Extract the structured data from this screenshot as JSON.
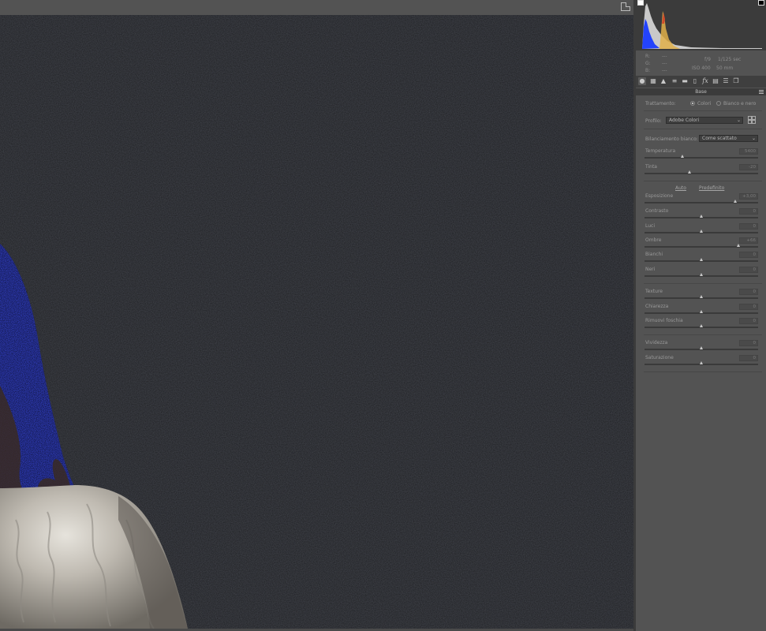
{
  "info": {
    "r_label": "R:",
    "g_label": "G:",
    "b_label": "B:",
    "r_value": "---",
    "g_value": "---",
    "b_value": "---",
    "aperture": "f/9",
    "shutter": "1/125 sec",
    "iso": "ISO 400",
    "focal": "50 mm"
  },
  "tools": [
    "basic-icon",
    "tone-curve-icon",
    "detail-icon",
    "hsl-icon",
    "split-toning-icon",
    "lens-icon",
    "effects-icon",
    "calibration-icon",
    "presets-icon",
    "snapshots-icon"
  ],
  "panel": {
    "section_title": "Base",
    "treatment_label": "Trattamento:",
    "treatment_color": "Colori",
    "treatment_bw": "Bianco e nero",
    "profile_label": "Profilo:",
    "profile_value": "Adobe Colori",
    "wb_label": "Bilanciamento bianco:",
    "wb_value": "Come scattato",
    "auto_label": "Auto",
    "default_label": "Predefinito"
  },
  "sliders": [
    {
      "key": "temperatura",
      "name": "Temperatura",
      "value": "5400",
      "pos": 0.34
    },
    {
      "key": "tinta",
      "name": "Tinta",
      "value": "-20",
      "pos": 0.4
    },
    {
      "key": "esposizione",
      "name": "Esposizione",
      "value": "+3,00",
      "pos": 0.8
    },
    {
      "key": "contrasto",
      "name": "Contrasto",
      "value": "0",
      "pos": 0.5
    },
    {
      "key": "luci",
      "name": "Luci",
      "value": "0",
      "pos": 0.5
    },
    {
      "key": "ombre",
      "name": "Ombre",
      "value": "+66",
      "pos": 0.83
    },
    {
      "key": "bianchi",
      "name": "Bianchi",
      "value": "0",
      "pos": 0.5
    },
    {
      "key": "neri",
      "name": "Neri",
      "value": "0",
      "pos": 0.5
    },
    {
      "key": "texture",
      "name": "Texture",
      "value": "0",
      "pos": 0.5
    },
    {
      "key": "chiarezza",
      "name": "Chiarezza",
      "value": "0",
      "pos": 0.5
    },
    {
      "key": "rimuovi-foschia",
      "name": "Rimuovi foschia",
      "value": "0",
      "pos": 0.5
    },
    {
      "key": "vividezza",
      "name": "Vividezza",
      "value": "0",
      "pos": 0.5
    },
    {
      "key": "saturazione",
      "name": "Saturazione",
      "value": "0",
      "pos": 0.5
    }
  ]
}
